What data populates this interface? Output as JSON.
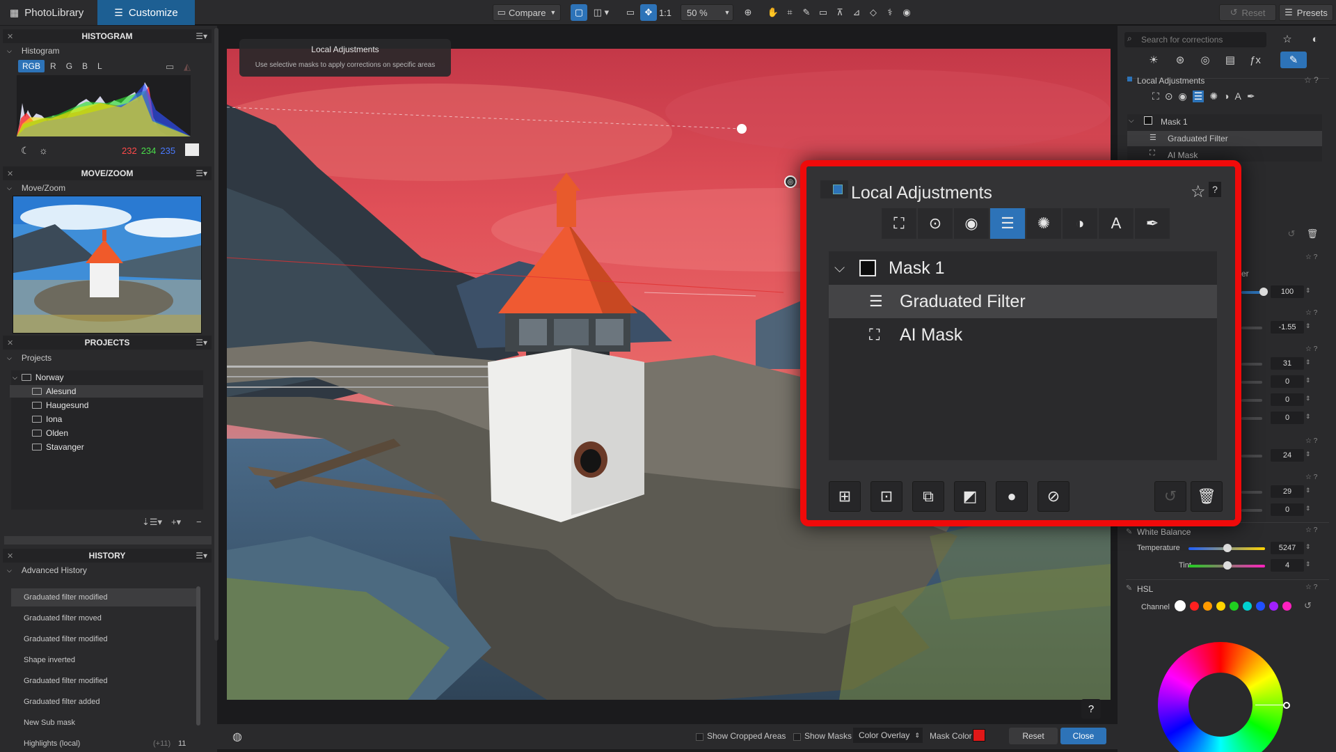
{
  "top": {
    "tab_library": "PhotoLibrary",
    "tab_customize": "Customize",
    "compare": "Compare",
    "one_to_one": "1:1",
    "zoom": "50 %",
    "reset": "Reset",
    "presets": "Presets"
  },
  "left": {
    "histogram_header": "HISTOGRAM",
    "histogram_sub": "Histogram",
    "rgb_tabs": [
      "RGB",
      "R",
      "G",
      "B",
      "L"
    ],
    "values": {
      "r": "232",
      "g": "234",
      "b": "235"
    },
    "movezoom_header": "MOVE/ZOOM",
    "movezoom_sub": "Move/Zoom",
    "projects_header": "PROJECTS",
    "projects_sub": "Projects",
    "project_root": "Norway",
    "projects": [
      "Alesund",
      "Haugesund",
      "Iona",
      "Olden",
      "Stavanger"
    ],
    "history_header": "HISTORY",
    "history_sub": "Advanced History",
    "history": [
      "Graduated filter modified",
      "Graduated filter moved",
      "Graduated filter modified",
      "Shape inverted",
      "Graduated filter modified",
      "Graduated filter added",
      "New Sub mask",
      "Highlights (local)"
    ],
    "history_last_extra": "(+11)",
    "history_last_value": "11"
  },
  "tooltip": {
    "title": "Local Adjustments",
    "desc": "Use selective masks to apply corrections on specific areas"
  },
  "right": {
    "search_placeholder": "Search for corrections",
    "local_adjustments": "Local Adjustments",
    "mask1": "Mask 1",
    "graduated": "Graduated Filter",
    "aimask": "AI Mask",
    "spin_values": [
      "100",
      "-1.55",
      "31",
      "0",
      "0",
      "0",
      "24",
      "29",
      "0"
    ],
    "white_balance": "White Balance",
    "temperature": "Temperature",
    "temperature_value": "5247",
    "tint": "Tint",
    "tint_value": "4",
    "hsl": "HSL",
    "channel": "Channel",
    "partial_label": "er",
    "channel_colors": [
      "#ffffff",
      "#ff2020",
      "#ff9a00",
      "#ffd400",
      "#20d020",
      "#00d0d0",
      "#2050ff",
      "#a020ff",
      "#ff20c0"
    ]
  },
  "overlay": {
    "title": "Local Adjustments",
    "mask": "Mask 1",
    "graduated": "Graduated Filter",
    "aimask": "AI Mask",
    "help": "?"
  },
  "bottom": {
    "show_cropped": "Show Cropped Areas",
    "show_masks": "Show Masks",
    "color_overlay": "Color Overlay",
    "mask_color": "Mask Color",
    "reset": "Reset",
    "close": "Close",
    "help": "?"
  },
  "colors": {
    "accent": "#2d73b8",
    "highlight": "#f00a0a",
    "mask_red": "#e04848"
  }
}
